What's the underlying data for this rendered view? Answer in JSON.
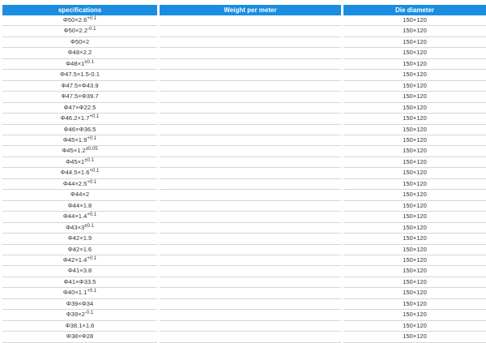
{
  "table": {
    "headers": [
      "specifications",
      "Weight per meter",
      "Die diameter"
    ],
    "rows": [
      {
        "spec": "Φ50×2.6",
        "sup": "+0.1",
        "weight": "",
        "die": "150×120"
      },
      {
        "spec": "Φ50×2.2",
        "sup": "-0.1",
        "weight": "",
        "die": "150×120"
      },
      {
        "spec": "Φ50×2",
        "sup": "",
        "weight": "",
        "die": "150×120"
      },
      {
        "spec": "Φ48×2.2",
        "sup": "",
        "weight": "",
        "die": "150×120"
      },
      {
        "spec": "Φ48×1",
        "sup": "±0.1",
        "weight": "",
        "die": "150×120"
      },
      {
        "spec": "Φ47.5×1.5-0.1",
        "sup": "",
        "weight": "",
        "die": "150×120"
      },
      {
        "spec": "Φ47.5×Φ43.9",
        "sup": "",
        "weight": "",
        "die": "150×120"
      },
      {
        "spec": "Φ47.5×Φ39.7",
        "sup": "",
        "weight": "",
        "die": "150×120"
      },
      {
        "spec": "Φ47×Φ22.5",
        "sup": "",
        "weight": "",
        "die": "150×120"
      },
      {
        "spec": "Φ46.2×1.7",
        "sup": "+0.1",
        "weight": "",
        "die": "150×120"
      },
      {
        "spec": "Φ46×Φ36.5",
        "sup": "",
        "weight": "",
        "die": "150×120"
      },
      {
        "spec": "Φ45×1.9",
        "sup": "+0.1",
        "weight": "",
        "die": "150×120"
      },
      {
        "spec": "Φ45×1.2",
        "sup": "±0.05",
        "weight": "",
        "die": "150×120"
      },
      {
        "spec": "Φ45×1",
        "sup": "±0.1",
        "weight": "",
        "die": "150×120"
      },
      {
        "spec": "Φ44.5×1.6",
        "sup": "+0.1",
        "weight": "",
        "die": "150×120"
      },
      {
        "spec": "Φ44×2.5",
        "sup": "+0.1",
        "weight": "",
        "die": "150×120"
      },
      {
        "spec": "Φ44×2",
        "sup": "",
        "weight": "",
        "die": "150×120"
      },
      {
        "spec": "Φ44×1.8",
        "sup": "",
        "weight": "",
        "die": "150×120"
      },
      {
        "spec": "Φ44×1.4",
        "sup": "+0.1",
        "weight": "",
        "die": "150×120"
      },
      {
        "spec": "Φ43×3",
        "sup": "±0.1",
        "weight": "",
        "die": "150×120"
      },
      {
        "spec": "Φ42×1.9",
        "sup": "",
        "weight": "",
        "die": "150×120"
      },
      {
        "spec": "Φ42×1.6",
        "sup": "",
        "weight": "",
        "die": "150×120"
      },
      {
        "spec": "Φ42×1.4",
        "sup": "+0.1",
        "weight": "",
        "die": "150×120"
      },
      {
        "spec": "Φ41×3.8",
        "sup": "",
        "weight": "",
        "die": "150×120"
      },
      {
        "spec": "Φ41×Φ33.5",
        "sup": "",
        "weight": "",
        "die": "150×120"
      },
      {
        "spec": "Φ40×1.1",
        "sup": "+0.1",
        "weight": "",
        "die": "150×120"
      },
      {
        "spec": "Φ39×Φ34",
        "sup": "",
        "weight": "",
        "die": "150×120"
      },
      {
        "spec": "Φ39×2",
        "sup": "-0.1",
        "weight": "",
        "die": "150×120"
      },
      {
        "spec": "Φ38.1×1.6",
        "sup": "",
        "weight": "",
        "die": "150×120"
      },
      {
        "spec": "Φ38×Φ28",
        "sup": "",
        "weight": "",
        "die": "150×120"
      }
    ]
  },
  "colors": {
    "header_bg": "#1a8de0",
    "header_text": "#ffffff",
    "row_border": "#d6d6d6",
    "body_text": "#333333"
  }
}
